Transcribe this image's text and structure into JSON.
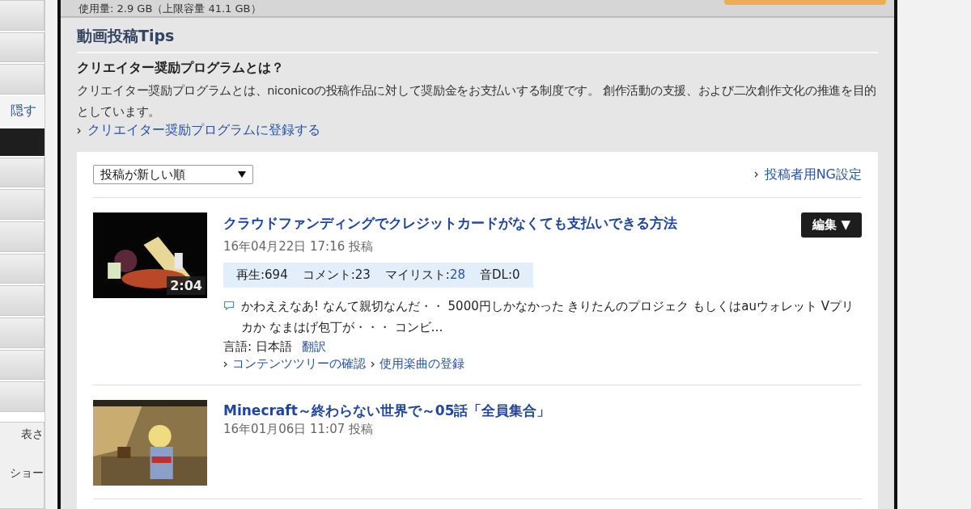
{
  "sidebar": {
    "hide_link": "隠す",
    "notes": [
      "表さ",
      "ショー"
    ]
  },
  "storage": {
    "usage": "使用量: 2.9 GB（上限容量 41.1 GB）"
  },
  "tips": {
    "title": "動画投稿Tips",
    "heading": "クリエイター奨励プログラムとは？",
    "body": "クリエイター奨励プログラムとは、niconicoの投稿作品に対して奨励金をお支払いする制度です。 創作活動の支援、および二次創作文化の推進を目的としています。",
    "link": "クリエイター奨励プログラムに登録する"
  },
  "list": {
    "sort": {
      "value": "投稿が新しい順"
    },
    "ng_link": "投稿者用NG設定",
    "videos": [
      {
        "title": "クラウドファンディングでクレジットカードがなくても支払いできる方法",
        "duration": "2:04",
        "posted": "16年04月22日 17:16 投稿",
        "edit": "編集 ▼",
        "stats": [
          {
            "label": "再生:",
            "value": "694",
            "linked": false
          },
          {
            "label": "コメント:",
            "value": "23",
            "linked": false
          },
          {
            "label": "マイリスト:",
            "value": "28",
            "linked": true
          },
          {
            "label": "音DL:",
            "value": "0",
            "linked": false
          }
        ],
        "comments": "かわええなあ! なんて親切なんだ・・ 5000円しかなかった きりたんのプロジェク もしくはauウォレット Vプリカか なまはげ包丁が・・・ コンビ…",
        "language": "言語: 日本語",
        "translate": "翻訳",
        "links": [
          "コンテンツツリーの確認",
          "使用楽曲の登録"
        ]
      },
      {
        "title": "Minecraft～終わらない世界で～05話「全員集合」",
        "posted": "16年01月06日 11:07 投稿"
      }
    ]
  }
}
